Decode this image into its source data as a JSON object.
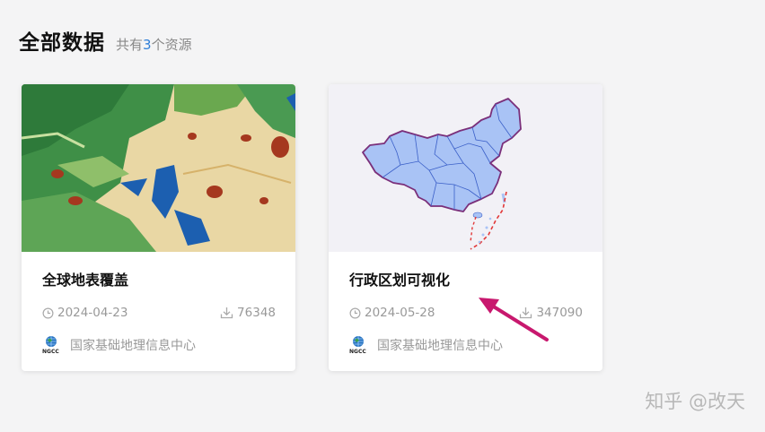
{
  "header": {
    "title": "全部数据",
    "count_prefix": "共有",
    "count": "3",
    "count_suffix": "个资源"
  },
  "cards": [
    {
      "title": "全球地表覆盖",
      "date": "2024-04-23",
      "downloads": "76348",
      "org": "国家基础地理信息中心",
      "org_abbr": "NGCC"
    },
    {
      "title": "行政区划可视化",
      "date": "2024-05-28",
      "downloads": "347090",
      "org": "国家基础地理信息中心",
      "org_abbr": "NGCC"
    }
  ],
  "watermark": "知乎 @改天",
  "colors": {
    "accent_count": "#2f7fd8",
    "annotation_arrow": "#c8186e",
    "map_fill": "#a9c3f5",
    "map_border": "#7a2f7a"
  },
  "icons": {
    "date": "clock-icon",
    "downloads": "download-icon",
    "org": "ngcc-logo-icon"
  }
}
